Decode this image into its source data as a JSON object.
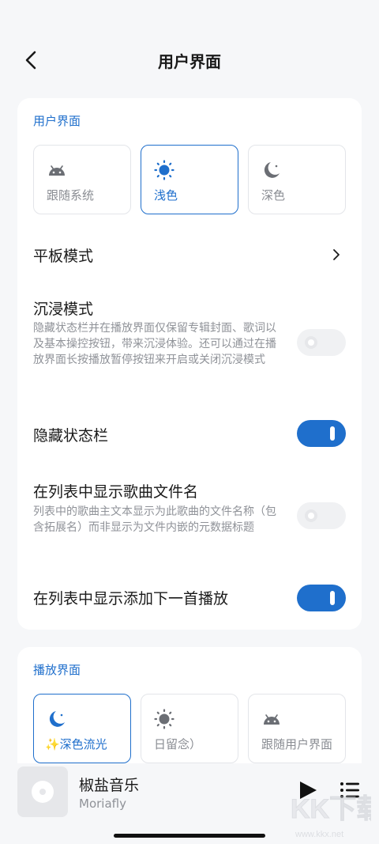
{
  "header": {
    "title": "用户界面",
    "back_icon": "chevron-left-icon"
  },
  "ui_section": {
    "label": "用户界面",
    "theme_options": [
      {
        "label": "跟随系统",
        "icon": "android-icon",
        "selected": false
      },
      {
        "label": "浅色",
        "icon": "sun-icon",
        "selected": true
      },
      {
        "label": "深色",
        "icon": "moon-icon",
        "selected": false
      }
    ],
    "tablet_mode": {
      "title": "平板模式"
    },
    "immersive_mode": {
      "title": "沉浸模式",
      "description": "隐藏状态栏并在播放界面仅保留专辑封面、歌词以及基本操控按钮，带来沉浸体验。还可以通过在播放界面长按播放暂停按钮来开启或关闭沉浸模式",
      "enabled": false
    },
    "hide_status_bar": {
      "title": "隐藏状态栏",
      "enabled": true
    },
    "show_filename": {
      "title": "在列表中显示歌曲文件名",
      "description": "列表中的歌曲主文本显示为此歌曲的文件名称（包含拓展名）而非显示为文件内嵌的元数据标题",
      "enabled": false
    },
    "show_add_next": {
      "title": "在列表中显示添加下一首播放",
      "enabled": true
    }
  },
  "player_section": {
    "label": "播放界面",
    "theme_options": [
      {
        "label": "✨深色流光",
        "icon": "moon-icon",
        "selected": true
      },
      {
        "label": "日留念）",
        "icon": "sun-icon",
        "selected": false
      },
      {
        "label": "跟随用户界面",
        "icon": "android-icon",
        "selected": false
      }
    ]
  },
  "mini_player": {
    "title": "椒盐音乐",
    "artist": "Moriafly",
    "cover_icon": "disc-icon",
    "play_icon": "play-icon",
    "queue_icon": "queue-list-icon"
  },
  "watermark": {
    "text": "KK下载",
    "url_text": "www.kkx.net"
  },
  "colors": {
    "accent": "#1f6fcc",
    "background": "#f6f7f9",
    "card": "#ffffff"
  }
}
